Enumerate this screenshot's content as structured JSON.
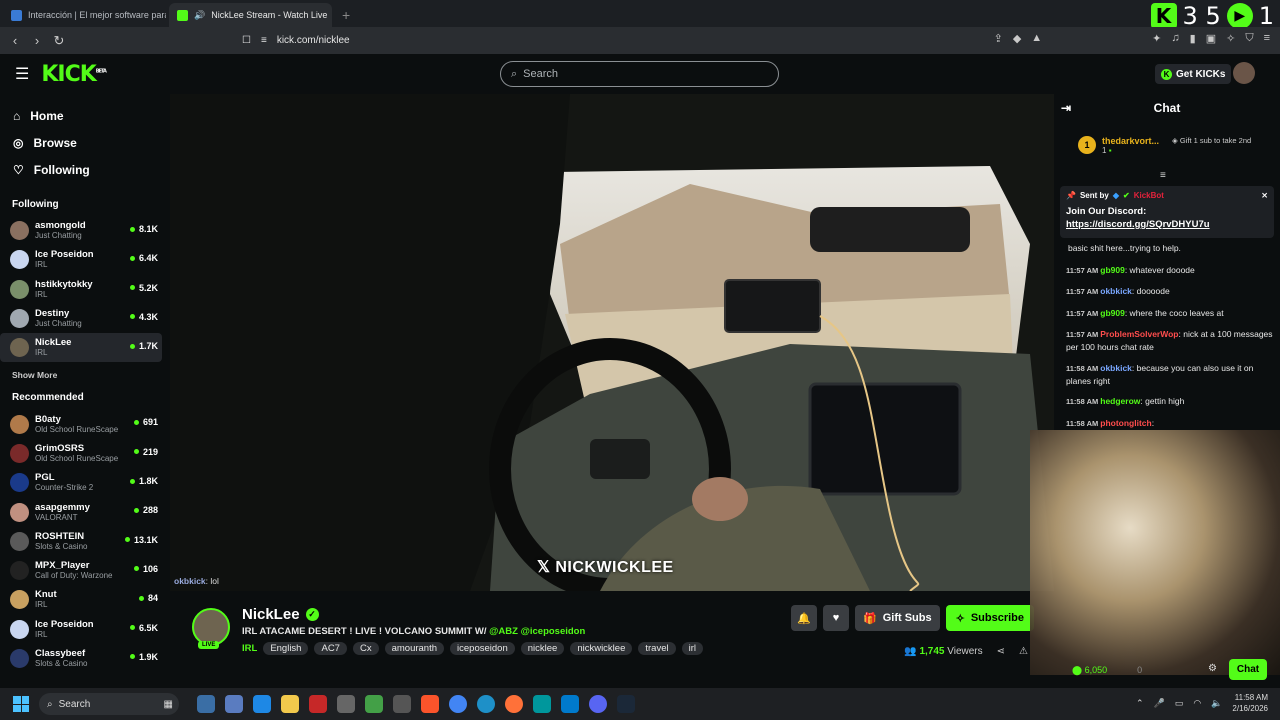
{
  "browser": {
    "tabs": [
      {
        "label": "Interacción | El mejor software para p",
        "active": false
      },
      {
        "label": "NickLee Stream - Watch Live",
        "active": true
      }
    ],
    "url": "kick.com/nicklee",
    "extension_counters": [
      "3 5",
      "1"
    ]
  },
  "header": {
    "logo": "KICK",
    "logo_badge": "BETA",
    "search_placeholder": "Search",
    "get_kicks_label": "Get KICKs"
  },
  "sidebar": {
    "nav": [
      {
        "label": "Home",
        "icon": "home-icon"
      },
      {
        "label": "Browse",
        "icon": "compass-icon"
      },
      {
        "label": "Following",
        "icon": "heart-icon"
      }
    ],
    "following_title": "Following",
    "following": [
      {
        "name": "asmongold",
        "category": "Just Chatting",
        "viewers": "8.1K",
        "color": "#8a7060"
      },
      {
        "name": "Ice Poseidon",
        "category": "IRL",
        "viewers": "6.4K",
        "color": "#c9d6f0"
      },
      {
        "name": "hstikkytokky",
        "category": "IRL",
        "viewers": "5.2K",
        "color": "#7a8f6a"
      },
      {
        "name": "Destiny",
        "category": "Just Chatting",
        "viewers": "4.3K",
        "color": "#a0a8b0"
      },
      {
        "name": "NickLee",
        "category": "IRL",
        "viewers": "1.7K",
        "color": "#6e6450"
      }
    ],
    "show_more": "Show More",
    "recommended_title": "Recommended",
    "recommended": [
      {
        "name": "B0aty",
        "category": "Old School RuneScape",
        "viewers": "691",
        "color": "#b07a4a"
      },
      {
        "name": "GrimOSRS",
        "category": "Old School RuneScape",
        "viewers": "219",
        "color": "#7a2a2a"
      },
      {
        "name": "PGL",
        "category": "Counter-Strike 2",
        "viewers": "1.8K",
        "color": "#1a3a8a"
      },
      {
        "name": "asapgemmy",
        "category": "VALORANT",
        "viewers": "288",
        "color": "#c09080"
      },
      {
        "name": "ROSHTEIN",
        "category": "Slots & Casino",
        "viewers": "13.1K",
        "color": "#5a5a5a"
      },
      {
        "name": "MPX_Player",
        "category": "Call of Duty: Warzone",
        "viewers": "106",
        "color": "#222222"
      },
      {
        "name": "Knut",
        "category": "IRL",
        "viewers": "84",
        "color": "#c8a060"
      },
      {
        "name": "Ice Poseidon",
        "category": "IRL",
        "viewers": "6.5K",
        "color": "#c9d6f0"
      },
      {
        "name": "Classybeef",
        "category": "Slots & Casino",
        "viewers": "1.9K",
        "color": "#2a3a6a"
      }
    ]
  },
  "video": {
    "overlay_text": "NICKWICKLEE",
    "overlay_chat_user": "okbkick",
    "overlay_chat_msg": "lol"
  },
  "stream": {
    "streamer": "NickLee",
    "live_label": "LIVE",
    "title_prefix": "IRL ATACAME DESERT ! LIVE ! VOLCANO SUMMIT W/ ",
    "title_mentions": "@ABZ @iceposeidon",
    "category": "IRL",
    "tags": [
      "English",
      "AC7",
      "Cx",
      "amouranth",
      "iceposeidon",
      "nicklee",
      "nickwicklee",
      "travel",
      "irl"
    ],
    "gift_subs_label": "Gift Subs",
    "subscribe_label": "Subscribe",
    "viewers_count": "1,745",
    "viewers_label": "Viewers"
  },
  "chat": {
    "title": "Chat",
    "leader_rank": "1",
    "leader_name": "thedarkvort...",
    "leader_count": "1",
    "gift_prompt": "Gift 1 sub to take 2nd",
    "pinned_sent_by": "Sent by",
    "pinned_bot": "KickBot",
    "pinned_msg_line1": "Join Our Discord:",
    "pinned_msg_link": "https://discord.gg/SQrvDHYU7u",
    "messages": [
      {
        "time": "",
        "user": "",
        "color": "#e8e8e8",
        "text": "basic shit here...trying to help."
      },
      {
        "time": "11:57 AM",
        "user": "gb909",
        "color": "#53fc18",
        "text": ": whatever dooode"
      },
      {
        "time": "11:57 AM",
        "user": "okbkick",
        "color": "#7aa7ff",
        "text": ": doooode"
      },
      {
        "time": "11:57 AM",
        "user": "gb909",
        "color": "#53fc18",
        "text": ": where the coco leaves at"
      },
      {
        "time": "11:57 AM",
        "user": "ProblemSolverWop",
        "color": "#ff4d4d",
        "text": ": nick at a 100 messages per 100 hours chat rate"
      },
      {
        "time": "11:58 AM",
        "user": "okbkick",
        "color": "#7aa7ff",
        "text": ": because you can also use it on planes right"
      },
      {
        "time": "11:58 AM",
        "user": "hedgerow",
        "color": "#53fc18",
        "text": ": gettin high"
      },
      {
        "time": "11:58 AM",
        "user": "photonglitch",
        "color": "#ff4d4d",
        "text": ":"
      }
    ],
    "points": "6,050",
    "points2": "0",
    "chat_button": "Chat"
  },
  "taskbar": {
    "search_label": "Search",
    "time": "11:58 AM",
    "date": "2/16/2026"
  }
}
